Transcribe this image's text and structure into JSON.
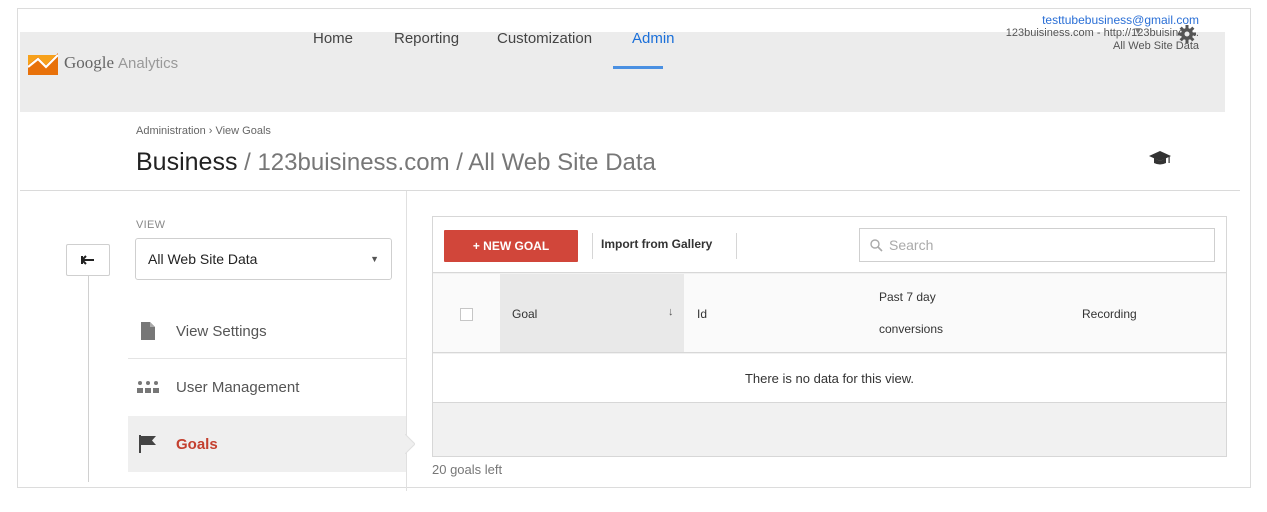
{
  "brand": {
    "name": "Google",
    "product": "Analytics"
  },
  "nav": {
    "home": "Home",
    "reporting": "Reporting",
    "customization": "Customization",
    "admin": "Admin"
  },
  "account": {
    "email": "testtubebusiness@gmail.com",
    "property": "123buisiness.com - http://123buisines...",
    "view": "All Web Site Data"
  },
  "header": {
    "breadcrumb": "Administration › View Goals",
    "title_main": "Business",
    "title_rest": " / 123buisiness.com / All Web Site Data"
  },
  "sidebar": {
    "view_label": "VIEW",
    "view_selected": "All Web Site Data",
    "items": [
      {
        "label": "View Settings",
        "icon": "document-icon"
      },
      {
        "label": "User Management",
        "icon": "users-icon"
      },
      {
        "label": "Goals",
        "icon": "flag-icon"
      }
    ]
  },
  "toolbar": {
    "new_goal": "+ NEW GOAL",
    "import": "Import from Gallery",
    "search_placeholder": "Search"
  },
  "table": {
    "columns": {
      "goal": "Goal",
      "id": "Id",
      "conv_line1": "Past 7 day",
      "conv_line2": "conversions",
      "recording": "Recording"
    },
    "empty_message": "There is no data for this view."
  },
  "footer": {
    "goals_left": "20 goals left"
  },
  "colors": {
    "accent_blue": "#1a6fd9",
    "new_goal_red": "#d1463a",
    "active_red": "#c4402f"
  }
}
